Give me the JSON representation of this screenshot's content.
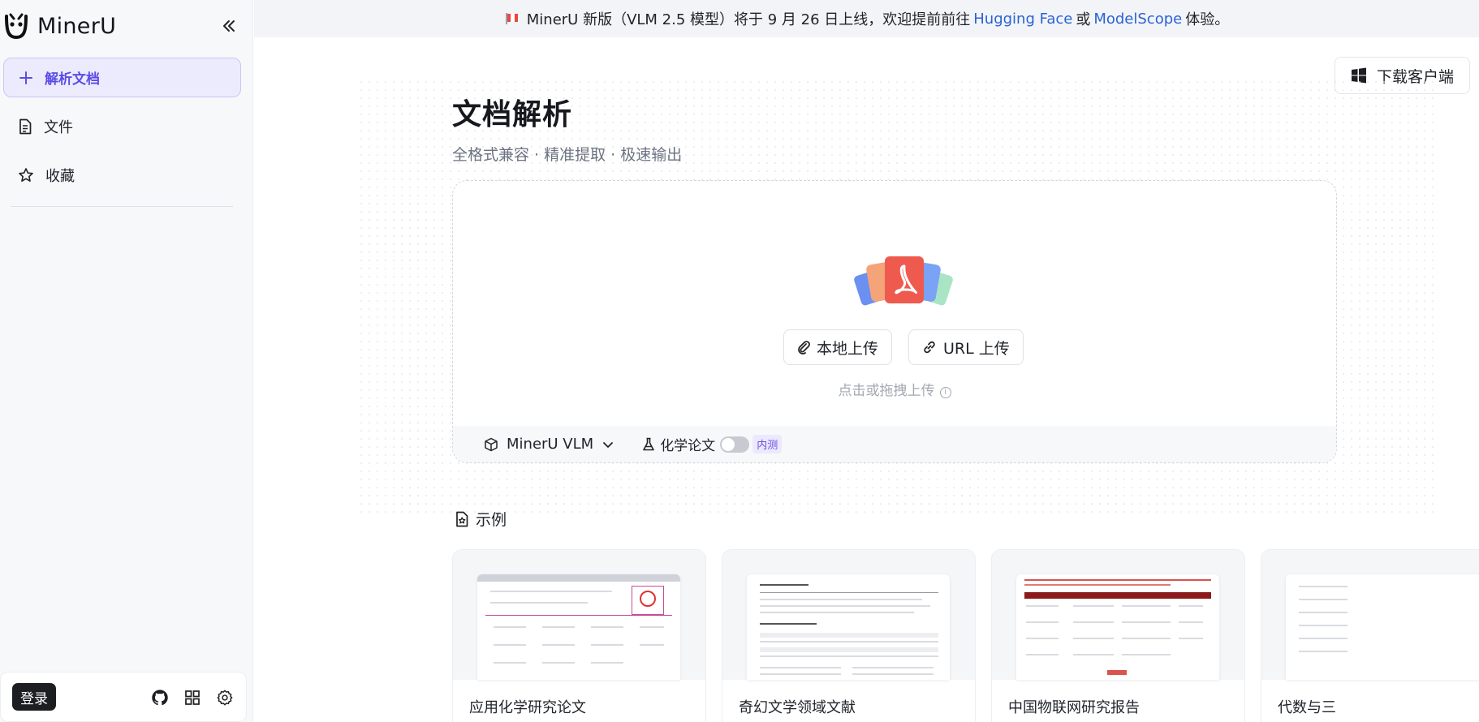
{
  "sidebar": {
    "brand_name": "MinerU",
    "new_doc_label": "解析文档",
    "items": [
      {
        "label": "文件",
        "icon": "file-icon"
      },
      {
        "label": "收藏",
        "icon": "star-icon"
      }
    ],
    "login_label": "登录",
    "footer_icons": [
      "github-icon",
      "apps-grid-icon",
      "gear-icon"
    ]
  },
  "banner": {
    "text_before": "MinerU 新版（VLM 2.5 模型）将于 9 月 26 日上线，欢迎提前前往",
    "link1": "Hugging Face",
    "connector": "或",
    "link2": "ModelScope",
    "text_after": "体验。"
  },
  "header": {
    "download_label": "下载客户端"
  },
  "main": {
    "title": "文档解析",
    "subtitle": "全格式兼容 · 精准提取 · 极速输出"
  },
  "upload": {
    "local_label": "本地上传",
    "url_label": "URL 上传",
    "hint": "点击或拖拽上传",
    "model_label": "MinerU VLM",
    "chem_label": "化学论文",
    "chem_enabled": false,
    "beta_badge": "内测"
  },
  "examples": {
    "heading": "示例",
    "items": [
      {
        "title": "应用化学研究论文"
      },
      {
        "title": "奇幻文学领域文献"
      },
      {
        "title": "中国物联网研究报告"
      },
      {
        "title": "代数与三"
      }
    ]
  },
  "colors": {
    "accent": "#5a4de6",
    "link": "#2a63d6",
    "login_bg": "#1d1e22"
  }
}
